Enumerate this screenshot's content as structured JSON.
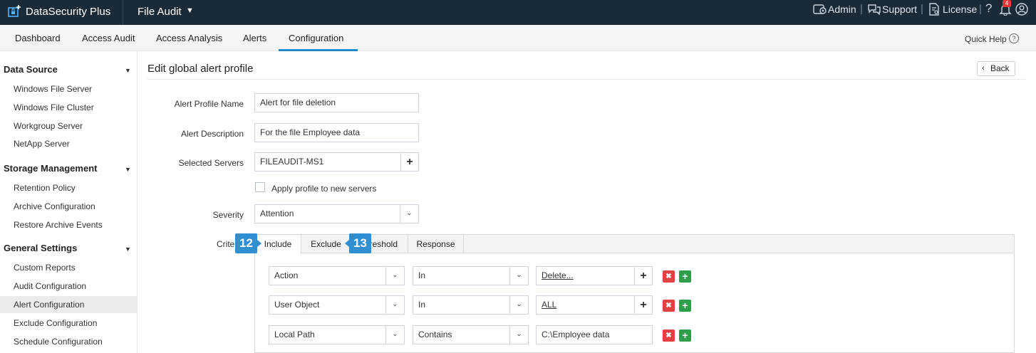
{
  "topbar": {
    "brand": "DataSecurity Plus",
    "product": "File Audit",
    "admin": "Admin",
    "support": "Support",
    "license": "License",
    "help": "?",
    "notification_count": "4"
  },
  "nav": {
    "tabs": [
      "Dashboard",
      "Access Audit",
      "Access Analysis",
      "Alerts",
      "Configuration"
    ],
    "active": "Configuration",
    "quick_help": "Quick Help"
  },
  "sidebar": {
    "sections": [
      {
        "title": "Data Source",
        "items": [
          "Windows File Server",
          "Windows File Cluster",
          "Workgroup Server",
          "NetApp Server"
        ]
      },
      {
        "title": "Storage Management",
        "items": [
          "Retention Policy",
          "Archive Configuration",
          "Restore Archive Events"
        ]
      },
      {
        "title": "General Settings",
        "items": [
          "Custom Reports",
          "Audit Configuration",
          "Alert Configuration",
          "Exclude Configuration",
          "Schedule Configuration"
        ]
      }
    ],
    "active_item": "Alert Configuration"
  },
  "page": {
    "title": "Edit global alert profile",
    "back_label": "Back"
  },
  "form": {
    "profile_name_label": "Alert Profile Name",
    "profile_name_value": "Alert for file deletion",
    "description_label": "Alert Description",
    "description_value": "For the file Employee data",
    "servers_label": "Selected Servers",
    "servers_value": "FILEAUDIT-MS1",
    "apply_new_servers_label": "Apply profile to new servers",
    "apply_new_servers_checked": false,
    "severity_label": "Severity",
    "severity_value": "Attention",
    "criteria_label": "Crite"
  },
  "criteria_tabs": {
    "tabs": [
      "Include",
      "Exclude",
      "reshold",
      "Response"
    ],
    "active": "Include",
    "callouts": [
      "12",
      "13"
    ]
  },
  "criteria_rows": [
    {
      "field": "Action",
      "operator": "In",
      "value": "Delete...",
      "value_picker": true
    },
    {
      "field": "User Object",
      "operator": "In",
      "value": "ALL",
      "value_picker": true
    },
    {
      "field": "Local Path",
      "operator": "Contains",
      "value": "C:\\Employee data",
      "value_picker": false
    }
  ],
  "colors": {
    "topbar": "#1b2a37",
    "accent": "#1e88c9",
    "callout": "#2f8fd0",
    "remove": "#e24141",
    "add": "#2e9e4a"
  }
}
